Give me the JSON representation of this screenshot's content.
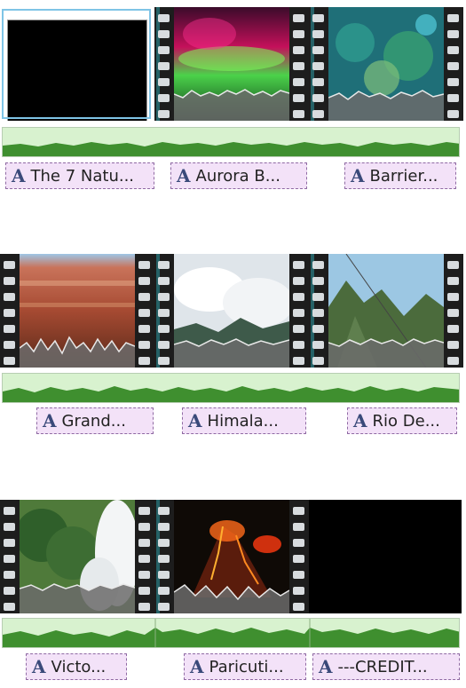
{
  "timeline": {
    "rows": [
      {
        "clips": [
          {
            "name": "black-clip",
            "thumb": "black",
            "selected": true
          },
          {
            "name": "aurora-clip",
            "thumb": "aurora"
          },
          {
            "name": "reef-clip",
            "thumb": "reef"
          }
        ],
        "titles": [
          {
            "label": "The 7 Natu..."
          },
          {
            "label": "Aurora B..."
          },
          {
            "label": "Barrier..."
          }
        ]
      },
      {
        "clips": [
          {
            "name": "canyon-clip",
            "thumb": "canyon"
          },
          {
            "name": "himalaya-clip",
            "thumb": "clouds"
          },
          {
            "name": "rio-clip",
            "thumb": "rio"
          }
        ],
        "titles": [
          {
            "label": "Grand..."
          },
          {
            "label": "Himala..."
          },
          {
            "label": "Rio De..."
          }
        ]
      },
      {
        "clips": [
          {
            "name": "victoria-clip",
            "thumb": "falls"
          },
          {
            "name": "paricutin-clip",
            "thumb": "volcano"
          },
          {
            "name": "credits-clip",
            "thumb": "black"
          }
        ],
        "titles": [
          {
            "label": "Victo..."
          },
          {
            "label": "Paricuti..."
          },
          {
            "label": "---CREDIT..."
          }
        ]
      }
    ]
  },
  "icons": {
    "title": "text-A-icon",
    "film": "film-strip-icon"
  }
}
